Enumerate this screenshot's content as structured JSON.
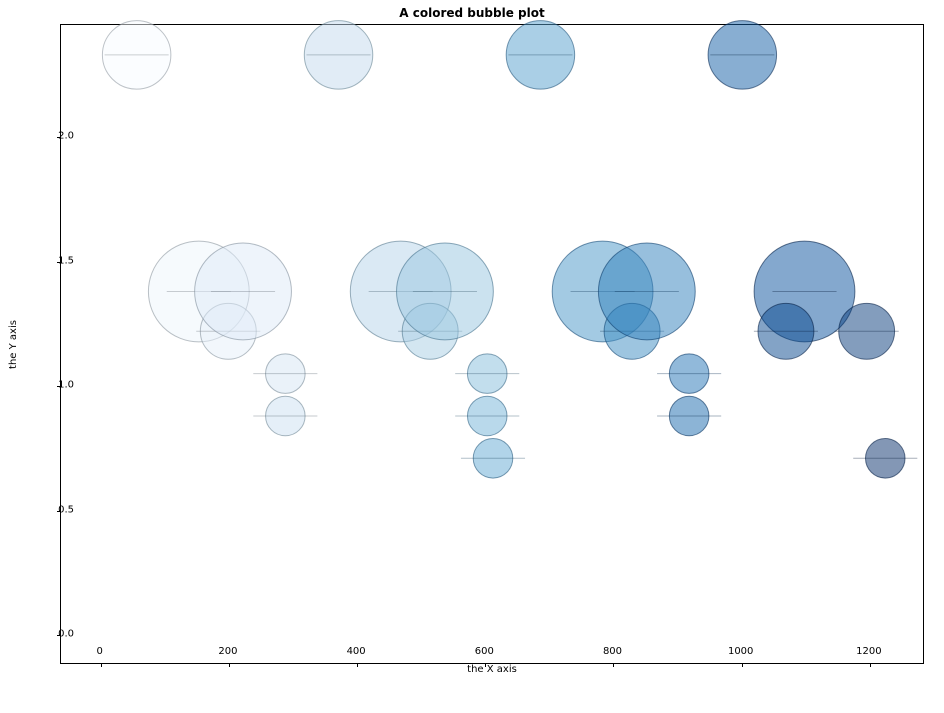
{
  "chart_data": {
    "type": "bubble",
    "title": "A colored bubble plot",
    "xlabel": "the X axis",
    "ylabel": "the Y axis",
    "xlim": [
      -62,
      1286
    ],
    "ylim": [
      -0.12,
      2.45
    ],
    "x_ticks": [
      0,
      200,
      400,
      600,
      800,
      1000,
      1200
    ],
    "y_ticks": [
      0.0,
      0.5,
      1.0,
      1.5,
      2.0
    ],
    "x_err": 50,
    "colormap": "Blues",
    "points": [
      {
        "x": 56,
        "y": 2.33,
        "size": 3000,
        "c": 0
      },
      {
        "x": 153,
        "y": 1.38,
        "size": 6500,
        "c": 1
      },
      {
        "x": 199,
        "y": 1.22,
        "size": 2000,
        "c": 2
      },
      {
        "x": 222,
        "y": 1.38,
        "size": 6000,
        "c": 3
      },
      {
        "x": 288,
        "y": 1.05,
        "size": 1000,
        "c": 4
      },
      {
        "x": 288,
        "y": 0.88,
        "size": 1000,
        "c": 5
      },
      {
        "x": 371,
        "y": 2.33,
        "size": 3000,
        "c": 6
      },
      {
        "x": 468,
        "y": 1.38,
        "size": 6500,
        "c": 7
      },
      {
        "x": 514,
        "y": 1.22,
        "size": 2000,
        "c": 8
      },
      {
        "x": 537,
        "y": 1.38,
        "size": 6000,
        "c": 9
      },
      {
        "x": 603,
        "y": 1.05,
        "size": 1000,
        "c": 10
      },
      {
        "x": 603,
        "y": 0.88,
        "size": 1000,
        "c": 11
      },
      {
        "x": 612,
        "y": 0.71,
        "size": 1000,
        "c": 12
      },
      {
        "x": 686,
        "y": 2.33,
        "size": 3000,
        "c": 13
      },
      {
        "x": 783,
        "y": 1.38,
        "size": 6500,
        "c": 14
      },
      {
        "x": 829,
        "y": 1.22,
        "size": 2000,
        "c": 15
      },
      {
        "x": 852,
        "y": 1.38,
        "size": 6000,
        "c": 16
      },
      {
        "x": 918,
        "y": 1.05,
        "size": 1000,
        "c": 17
      },
      {
        "x": 918,
        "y": 0.88,
        "size": 1000,
        "c": 18
      },
      {
        "x": 1001,
        "y": 2.33,
        "size": 3000,
        "c": 19
      },
      {
        "x": 1098,
        "y": 1.38,
        "size": 6500,
        "c": 20
      },
      {
        "x": 1069,
        "y": 1.22,
        "size": 2000,
        "c": 21
      },
      {
        "x": 1195,
        "y": 1.22,
        "size": 2000,
        "c": 22
      },
      {
        "x": 1224,
        "y": 0.71,
        "size": 1000,
        "c": 23
      }
    ]
  }
}
